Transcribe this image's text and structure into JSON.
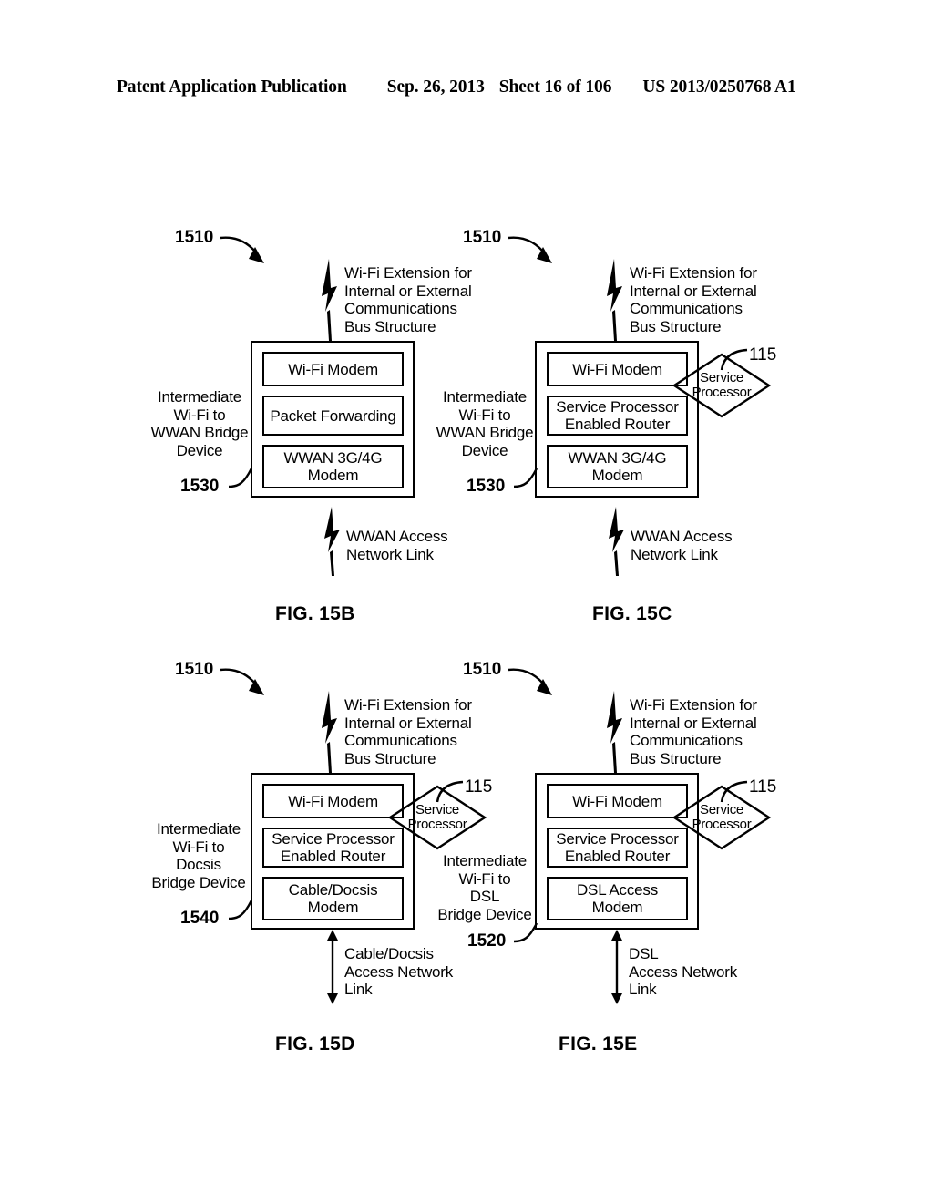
{
  "header": {
    "title": "Patent Application Publication",
    "date": "Sep. 26, 2013",
    "sheet": "Sheet 16 of 106",
    "pub_number": "US 2013/0250768 A1"
  },
  "common": {
    "wifi_extension_label": "Wi-Fi Extension for\nInternal or External\nCommunications\nBus Structure",
    "wifi_modem": "Wi-Fi Modem",
    "service_processor_router": "Service Processor\nEnabled Router",
    "service_processor_diamond": {
      "line1": "Service",
      "line2": "Processor"
    },
    "ref_1510": "1510",
    "ref_115": "115"
  },
  "figures": [
    {
      "id": "fig-15b",
      "caption": "FIG. 15B",
      "device_label": "Intermediate\nWi-Fi to\nWWAN Bridge\nDevice",
      "device_ref": "1530",
      "top_link_label": "Wi-Fi Extension for\nInternal or External\nCommunications\nBus Structure",
      "bottom_link_label": "WWAN Access\nNetwork Link",
      "bottom_link_type": "lightning",
      "has_service_processor": false,
      "modules": [
        "Wi-Fi Modem",
        "Packet Forwarding",
        "WWAN 3G/4G\nModem"
      ]
    },
    {
      "id": "fig-15c",
      "caption": "FIG. 15C",
      "device_label": "Intermediate\nWi-Fi to\nWWAN Bridge\nDevice",
      "device_ref": "1530",
      "top_link_label": "Wi-Fi Extension for\nInternal or External\nCommunications\nBus Structure",
      "bottom_link_label": "WWAN Access\nNetwork Link",
      "bottom_link_type": "lightning",
      "has_service_processor": true,
      "modules": [
        "Wi-Fi Modem",
        "Service Processor\nEnabled Router",
        "WWAN 3G/4G\nModem"
      ]
    },
    {
      "id": "fig-15d",
      "caption": "FIG. 15D",
      "device_label": "Intermediate\nWi-Fi to\nDocsis\nBridge Device",
      "device_ref": "1540",
      "top_link_label": "Wi-Fi Extension for\nInternal or External\nCommunications\nBus Structure",
      "bottom_link_label": "Cable/Docsis\nAccess Network\nLink",
      "bottom_link_type": "arrow",
      "has_service_processor": true,
      "modules": [
        "Wi-Fi Modem",
        "Service Processor\nEnabled Router",
        "Cable/Docsis\nModem"
      ]
    },
    {
      "id": "fig-15e",
      "caption": "FIG. 15E",
      "device_label": "Intermediate\nWi-Fi to\nDSL\nBridge Device",
      "device_ref": "1520",
      "top_link_label": "Wi-Fi Extension for\nInternal or External\nCommunications\nBus Structure",
      "bottom_link_label": "DSL\nAccess Network\nLink",
      "bottom_link_type": "arrow",
      "has_service_processor": true,
      "modules": [
        "Wi-Fi Modem",
        "Service Processor\nEnabled Router",
        "DSL Access\nModem"
      ]
    }
  ]
}
